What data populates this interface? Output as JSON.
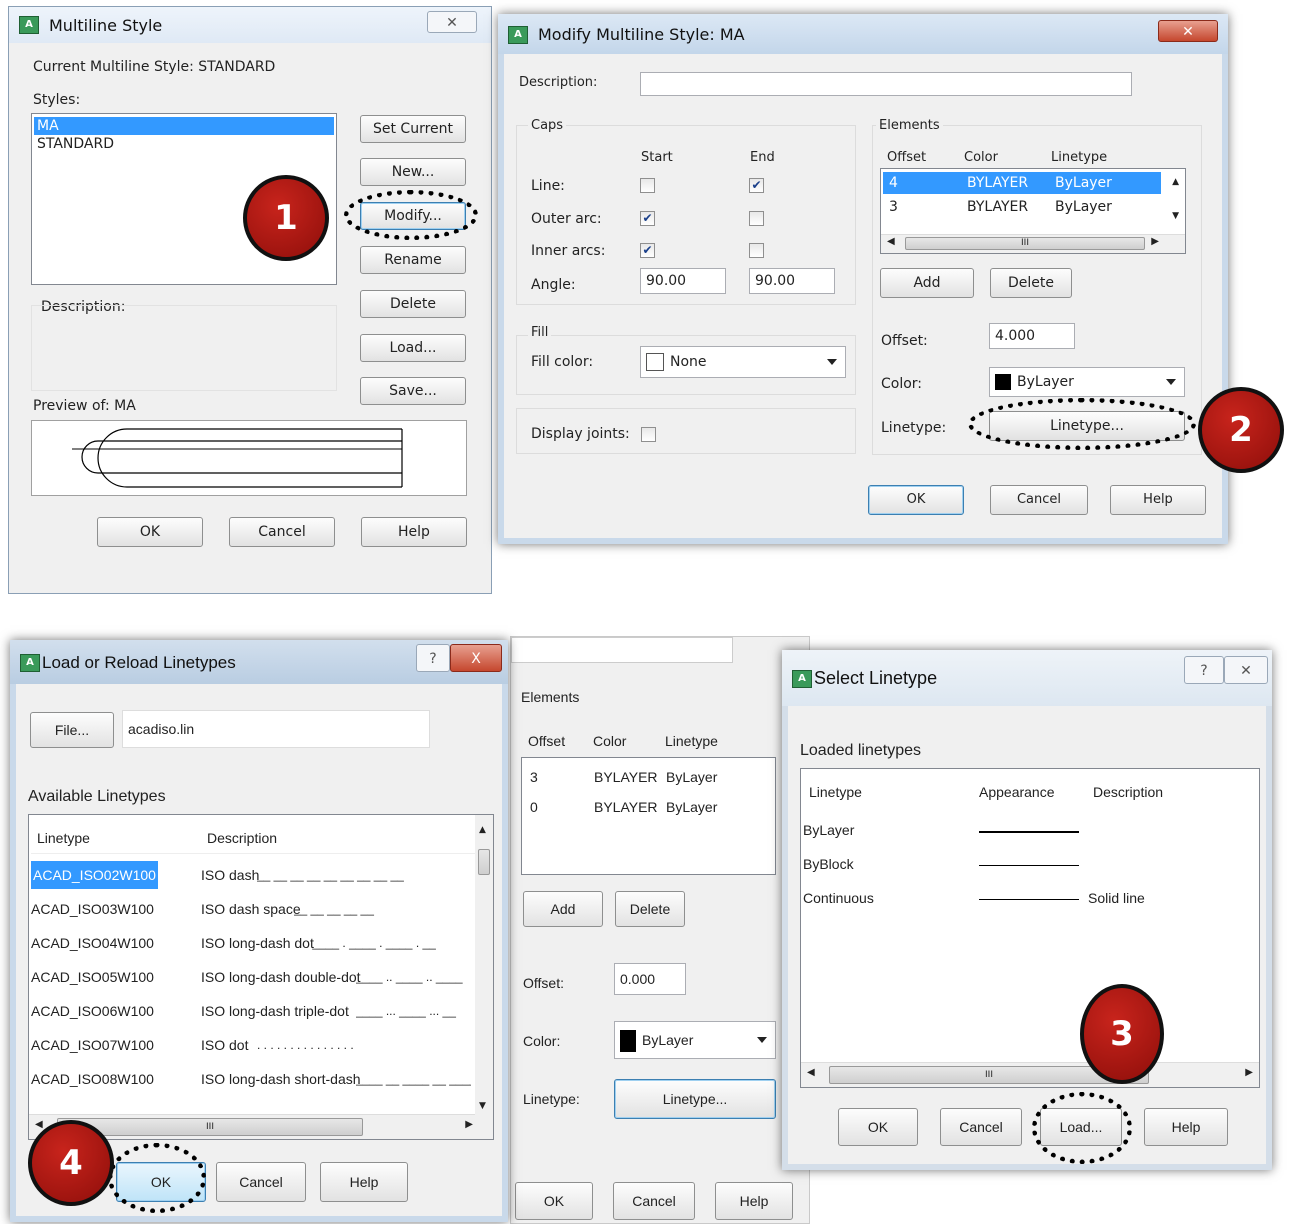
{
  "dlg1": {
    "title": "Multiline Style",
    "close": "✕",
    "current_label": "Current Multiline Style: STANDARD",
    "styles_label": "Styles:",
    "styles": [
      "MA",
      "STANDARD"
    ],
    "buttons": {
      "set_current": "Set Current",
      "new": "New...",
      "modify": "Modify...",
      "rename": "Rename",
      "delete": "Delete",
      "load": "Load...",
      "save": "Save..."
    },
    "description_label": "Description:",
    "preview_label": "Preview of: MA",
    "ok": "OK",
    "cancel": "Cancel",
    "help": "Help"
  },
  "dlg2": {
    "title": "Modify Multiline Style: MA",
    "close": "✕",
    "description_label": "Description:",
    "caps_label": "Caps",
    "start_label": "Start",
    "end_label": "End",
    "line_label": "Line:",
    "outer_arc_label": "Outer arc:",
    "inner_arcs_label": "Inner arcs:",
    "angle_label": "Angle:",
    "angle_start": "90.00",
    "angle_end": "90.00",
    "checks": {
      "line_start": false,
      "line_end": true,
      "outer_start": true,
      "outer_end": false,
      "inner_start": true,
      "inner_end": false
    },
    "fill_label": "Fill",
    "fill_color_label": "Fill color:",
    "fill_color_value": "None",
    "display_joints_label": "Display joints:",
    "elements_label": "Elements",
    "col_offset": "Offset",
    "col_color": "Color",
    "col_linetype": "Linetype",
    "elements": [
      {
        "offset": "4",
        "color": "BYLAYER",
        "linetype": "ByLayer"
      },
      {
        "offset": "3",
        "color": "BYLAYER",
        "linetype": "ByLayer"
      }
    ],
    "scroll_mark": "III",
    "add": "Add",
    "delete": "Delete",
    "offset_label": "Offset:",
    "offset_value": "4.000",
    "color_label": "Color:",
    "color_value": "ByLayer",
    "linetype_label": "Linetype:",
    "linetype_btn": "Linetype...",
    "ok": "OK",
    "cancel": "Cancel",
    "help": "Help"
  },
  "dlg3": {
    "title": "Load or Reload Linetypes",
    "help_q": "?",
    "close": "X",
    "file_btn": "File...",
    "file_value": "acadiso.lin",
    "available_label": "Available Linetypes",
    "col_linetype": "Linetype",
    "col_description": "Description",
    "rows": [
      {
        "name": "ACAD_ISO02W100",
        "desc": "ISO dash",
        "pattern": "__ __ __ __ __ __ __ __ __"
      },
      {
        "name": "ACAD_ISO03W100",
        "desc": "ISO dash space",
        "pattern": "__   __   __   __   __"
      },
      {
        "name": "ACAD_ISO04W100",
        "desc": "ISO long-dash dot",
        "pattern": "____ . ____ . ____ . __"
      },
      {
        "name": "ACAD_ISO05W100",
        "desc": "ISO long-dash double-dot",
        "pattern": "____ .. ____ .. ____"
      },
      {
        "name": "ACAD_ISO06W100",
        "desc": "ISO long-dash triple-dot",
        "pattern": "____ ... ____ ... __"
      },
      {
        "name": "ACAD_ISO07W100",
        "desc": "ISO dot",
        "pattern": ". . . . . . . . . . . . . . ."
      },
      {
        "name": "ACAD_ISO08W100",
        "desc": "ISO long-dash short-dash",
        "pattern": "____ __ ____ __ ____"
      }
    ],
    "scroll_mark": "III",
    "ok": "OK",
    "cancel": "Cancel",
    "help": "Help"
  },
  "dlg4bg": {
    "elements_label": "Elements",
    "col_offset": "Offset",
    "col_color": "Color",
    "col_linetype": "Linetype",
    "elements": [
      {
        "offset": "3",
        "color": "BYLAYER",
        "linetype": "ByLayer"
      },
      {
        "offset": "0",
        "color": "BYLAYER",
        "linetype": "ByLayer"
      }
    ],
    "add": "Add",
    "delete": "Delete",
    "offset_label": "Offset:",
    "offset_value": "0.000",
    "color_label": "Color:",
    "color_value": "ByLayer",
    "linetype_label": "Linetype:",
    "linetype_btn": "Linetype...",
    "ok": "OK",
    "cancel": "Cancel",
    "help": "Help"
  },
  "dlg5": {
    "title": "Select Linetype",
    "help_q": "?",
    "close": "✕",
    "loaded_label": "Loaded linetypes",
    "col_linetype": "Linetype",
    "col_appearance": "Appearance",
    "col_description": "Description",
    "rows": [
      {
        "name": "ByLayer",
        "desc": ""
      },
      {
        "name": "ByBlock",
        "desc": ""
      },
      {
        "name": "Continuous",
        "desc": "Solid line"
      }
    ],
    "scroll_mark": "III",
    "ok": "OK",
    "cancel": "Cancel",
    "load": "Load...",
    "help": "Help"
  },
  "markers": [
    "1",
    "2",
    "3",
    "4"
  ],
  "colors": {
    "selection": "#3399ff",
    "marker_red": "#b01a14",
    "title_gradient": "#d6e4f3"
  }
}
